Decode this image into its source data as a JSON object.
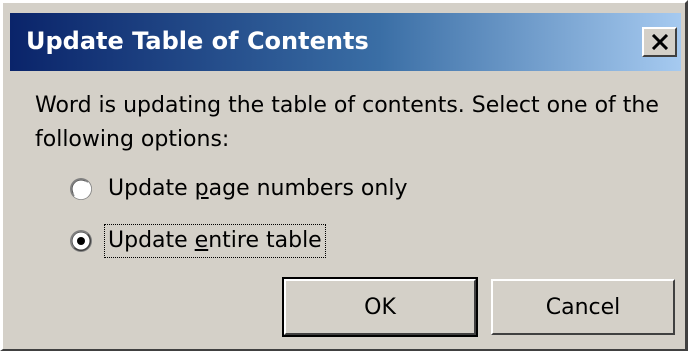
{
  "window": {
    "title": "Update Table of Contents",
    "close_glyph": "X"
  },
  "message": "Word is updating the table of contents.  Select one of the following options:",
  "options": [
    {
      "label_pre": "Update ",
      "label_accel": "p",
      "label_post": "age numbers only",
      "selected": false
    },
    {
      "label_pre": "Update ",
      "label_accel": "e",
      "label_post": "ntire table",
      "selected": true
    }
  ],
  "buttons": {
    "ok_label": "OK",
    "cancel_label": "Cancel"
  },
  "colors": {
    "dialog_face": "#d4d0c8",
    "title_start": "#0a246a",
    "title_end": "#a6caf0",
    "title_text": "#ffffff"
  },
  "icons": {
    "close": "close-icon",
    "radio_unselected": "radio-unselected-icon",
    "radio_selected": "radio-selected-icon"
  }
}
